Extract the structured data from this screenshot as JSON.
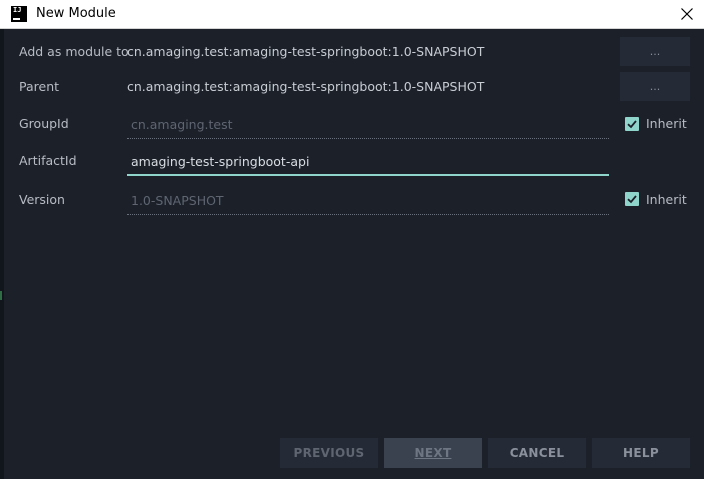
{
  "window": {
    "title": "New Module",
    "icon": "intellij-icon",
    "icon_text": "IJ"
  },
  "form": {
    "add_as_module_to": {
      "label": "Add as module to",
      "value": "cn.amaging.test:amaging-test-springboot:1.0-SNAPSHOT",
      "button": "..."
    },
    "parent": {
      "label": "Parent",
      "value": "cn.amaging.test:amaging-test-springboot:1.0-SNAPSHOT",
      "button": "..."
    },
    "group_id": {
      "label": "GroupId",
      "value": "cn.amaging.test",
      "inherit_label": "Inherit",
      "inherit_checked": true
    },
    "artifact_id": {
      "label": "ArtifactId",
      "value": "amaging-test-springboot-api"
    },
    "version": {
      "label": "Version",
      "value": "1.0-SNAPSHOT",
      "inherit_label": "Inherit",
      "inherit_checked": true
    }
  },
  "footer": {
    "previous": "PREVIOUS",
    "next": "NEXT",
    "cancel": "CANCEL",
    "help": "HELP"
  },
  "colors": {
    "background": "#1b2029",
    "accent": "#8fd5cb",
    "button_bg": "#252b36"
  }
}
